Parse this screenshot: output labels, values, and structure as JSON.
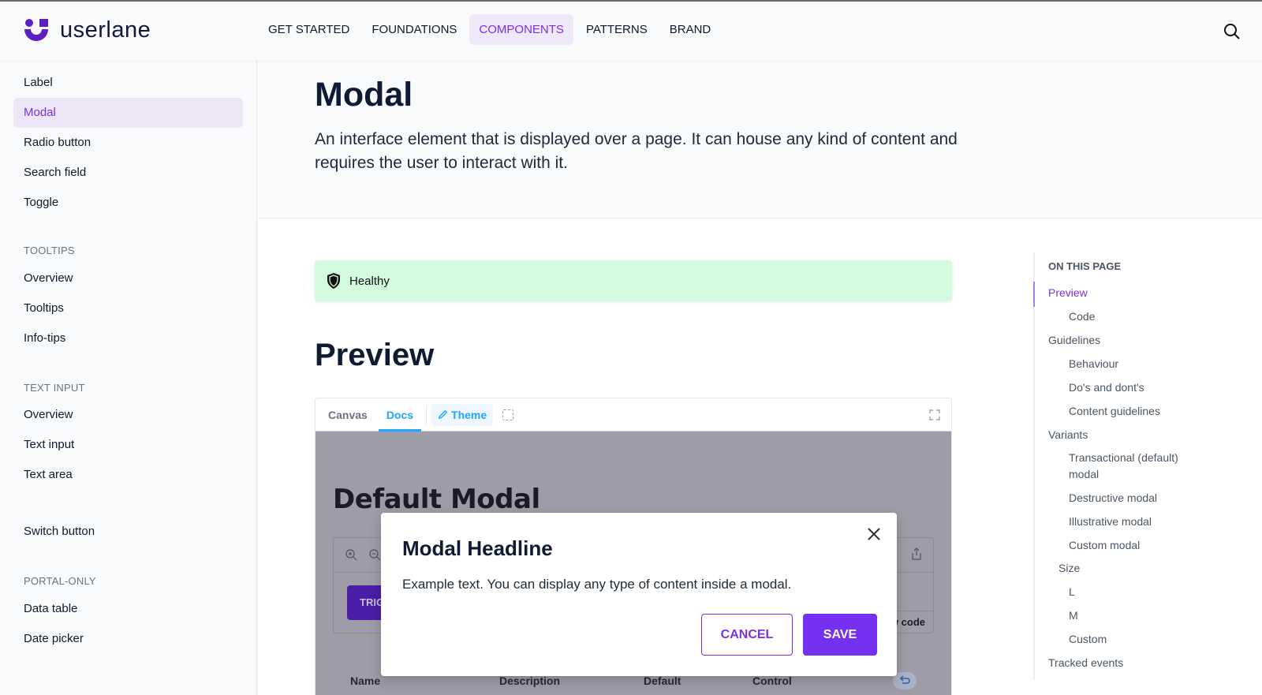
{
  "brand": {
    "name": "userlane",
    "accent": "#7c2fe8"
  },
  "nav": {
    "items": [
      {
        "label": "GET STARTED",
        "active": false
      },
      {
        "label": "FOUNDATIONS",
        "active": false
      },
      {
        "label": "COMPONENTS",
        "active": true
      },
      {
        "label": "PATTERNS",
        "active": false
      },
      {
        "label": "BRAND",
        "active": false
      }
    ],
    "search_icon": "search-icon"
  },
  "sidebar": {
    "items": [
      {
        "label": "Label"
      },
      {
        "label": "Modal",
        "active": true
      },
      {
        "label": "Radio button"
      },
      {
        "label": "Search field"
      },
      {
        "label": "Toggle"
      }
    ],
    "sections": [
      {
        "heading": "TOOLTIPS",
        "items": [
          "Overview",
          "Tooltips",
          "Info-tips"
        ]
      },
      {
        "heading": "TEXT INPUT",
        "items": [
          "Overview",
          "Text input",
          "Text area"
        ]
      },
      {
        "heading": "",
        "items": [
          "Switch button"
        ]
      },
      {
        "heading": "PORTAL-ONLY",
        "items": [
          "Data table",
          "Date picker"
        ]
      }
    ]
  },
  "hero": {
    "title": "Modal",
    "description": "An interface element that is displayed over a page. It can house any kind of content and requires the user to interact with it."
  },
  "status": {
    "label": "Healthy",
    "icon": "shield-icon",
    "color": "#d3fcdf"
  },
  "preview": {
    "heading": "Preview",
    "toolbar": {
      "tabs": [
        {
          "label": "Canvas",
          "active": false
        },
        {
          "label": "Docs",
          "active": true
        }
      ],
      "theme_label": "Theme"
    },
    "canvas": {
      "title": "Default Modal",
      "trigger_label": "TRIGGER",
      "show_code_label": "Show code",
      "args_columns": [
        "Name",
        "Description",
        "Default",
        "Control"
      ]
    },
    "modal": {
      "headline": "Modal Headline",
      "body": "Example text. You can display any type of content inside a modal.",
      "cancel_label": "CANCEL",
      "save_label": "SAVE"
    }
  },
  "toc": {
    "heading": "ON THIS PAGE",
    "items": [
      {
        "label": "Preview",
        "level": 1,
        "active": true
      },
      {
        "label": "Code",
        "level": 2
      },
      {
        "label": "Guidelines",
        "level": 1
      },
      {
        "label": "Behaviour",
        "level": 2
      },
      {
        "label": "Do's and dont's",
        "level": 2
      },
      {
        "label": "Content guidelines",
        "level": 2
      },
      {
        "label": "Variants",
        "level": 1
      },
      {
        "label": "Transactional (default) modal",
        "level": 2
      },
      {
        "label": "Destructive modal",
        "level": 2
      },
      {
        "label": "Illustrative modal",
        "level": 2
      },
      {
        "label": "Custom modal",
        "level": 2
      },
      {
        "label": "Size",
        "level": 1.5
      },
      {
        "label": "L",
        "level": 2
      },
      {
        "label": "M",
        "level": 2
      },
      {
        "label": "Custom",
        "level": 2
      },
      {
        "label": "Tracked events",
        "level": 1
      }
    ]
  }
}
